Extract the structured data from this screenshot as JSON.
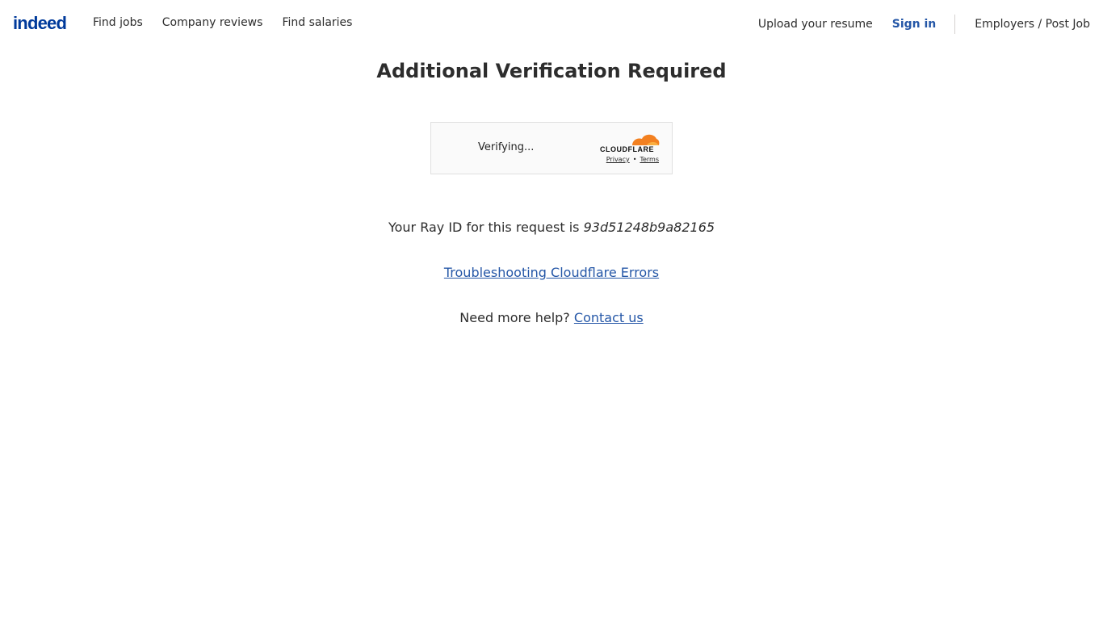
{
  "header": {
    "logo": "indeed",
    "nav_left": [
      "Find jobs",
      "Company reviews",
      "Find salaries"
    ],
    "upload": "Upload your resume",
    "sign_in": "Sign in",
    "employers": "Employers / Post Job"
  },
  "main": {
    "title": "Additional Verification Required",
    "widget": {
      "status": "Verifying...",
      "brand": "CLOUDFLARE",
      "privacy": "Privacy",
      "separator": "•",
      "terms": "Terms"
    },
    "ray_prefix": "Your Ray ID for this request is",
    "ray_id": "93d51248b9a82165",
    "troubleshoot_link": "Troubleshooting Cloudflare Errors",
    "help_prefix": "Need more help?",
    "contact_link": "Contact us"
  },
  "colors": {
    "brand_blue": "#003a9b",
    "link_blue": "#2557a7",
    "cloudflare_orange": "#f38020"
  }
}
